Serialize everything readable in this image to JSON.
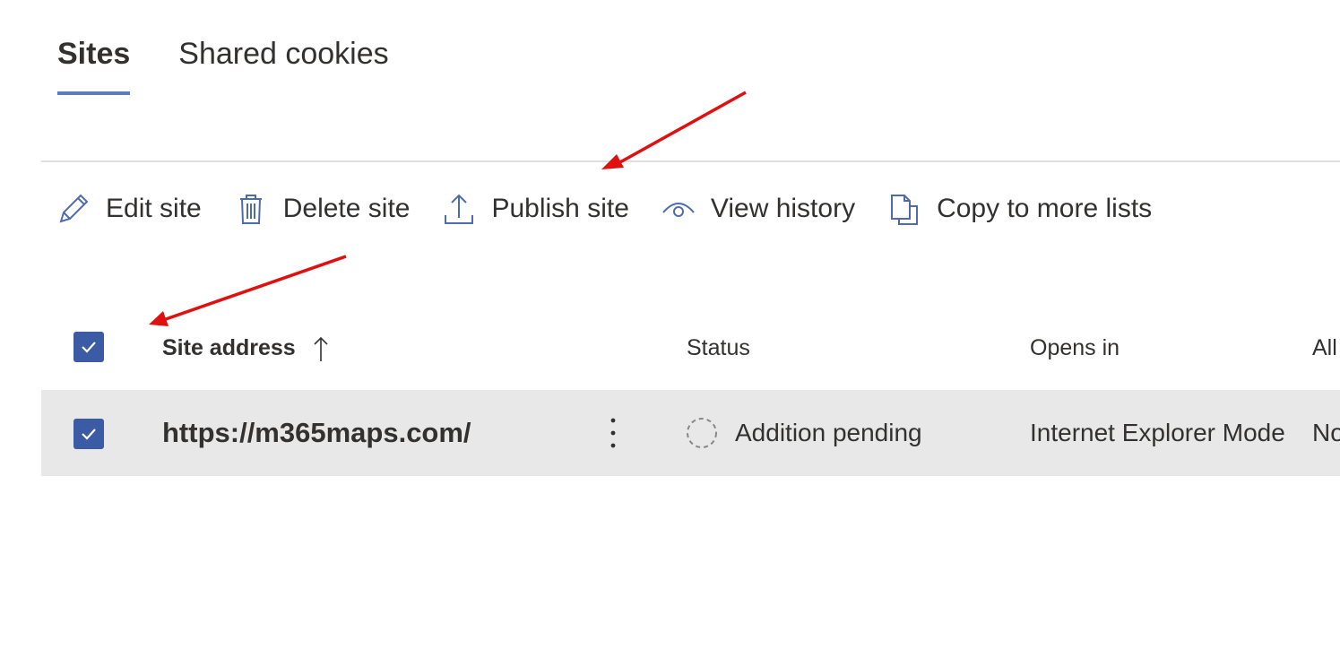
{
  "tabs": [
    {
      "label": "Sites",
      "active": true
    },
    {
      "label": "Shared cookies",
      "active": false
    }
  ],
  "toolbar": {
    "edit_label": "Edit site",
    "delete_label": "Delete site",
    "publish_label": "Publish site",
    "history_label": "View history",
    "copy_label": "Copy to more lists",
    "icons": [
      "pencil-icon",
      "trash-icon",
      "upload-icon",
      "eye-icon",
      "copy-icon"
    ]
  },
  "table": {
    "columns": {
      "site_address": "Site address",
      "status": "Status",
      "opens_in": "Opens in",
      "allow": "All"
    },
    "sort_icon": "arrow-up-icon",
    "select_all_checked": true,
    "rows": [
      {
        "selected": true,
        "site_address": "https://m365maps.com/",
        "status": "Addition pending",
        "opens_in": "Internet Explorer Mode",
        "allow": "No"
      }
    ]
  },
  "colors": {
    "accent": "#5b7bc0",
    "checkbox": "#3b5ba5",
    "row_selected": "#e8e8e8",
    "annotation_arrow": "#e01010"
  }
}
